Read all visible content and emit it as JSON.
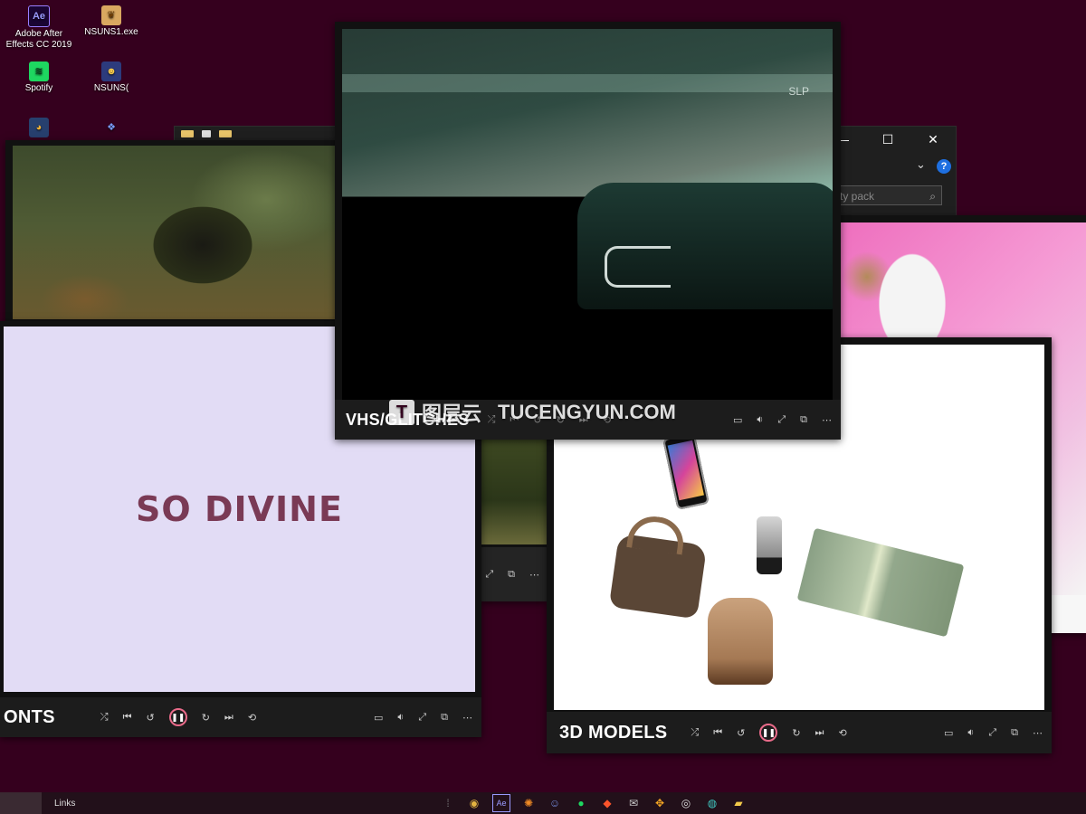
{
  "desktop": {
    "icons": [
      {
        "label": "Adobe After Effects CC 2019",
        "short": "Ae"
      },
      {
        "label": "NSUNS1.exe",
        "short": ""
      },
      {
        "label": "Spotify",
        "short": ""
      },
      {
        "label": "NSUNS(",
        "short": ""
      },
      {
        "label": "",
        "short": ""
      },
      {
        "label": "",
        "short": ""
      }
    ]
  },
  "explorer": {
    "search_placeholder": "ty pack",
    "minimize": "—",
    "maximize": "☐",
    "close": "✕",
    "help": "?"
  },
  "windows": {
    "fonts": {
      "title": "ONTS",
      "display_text": "SO DIVINE"
    },
    "vhs": {
      "title": "VHS/GLITCHES",
      "watermark": "SLP"
    },
    "models": {
      "title": "3D MODELS"
    }
  },
  "watermark": {
    "cn": "图层云",
    "en": "TUCENGYUN.COM",
    "logo": "T"
  },
  "taskbar": {
    "links": "Links"
  },
  "colors": {
    "desktop": "#35001e",
    "accent": "#e96b8a"
  }
}
